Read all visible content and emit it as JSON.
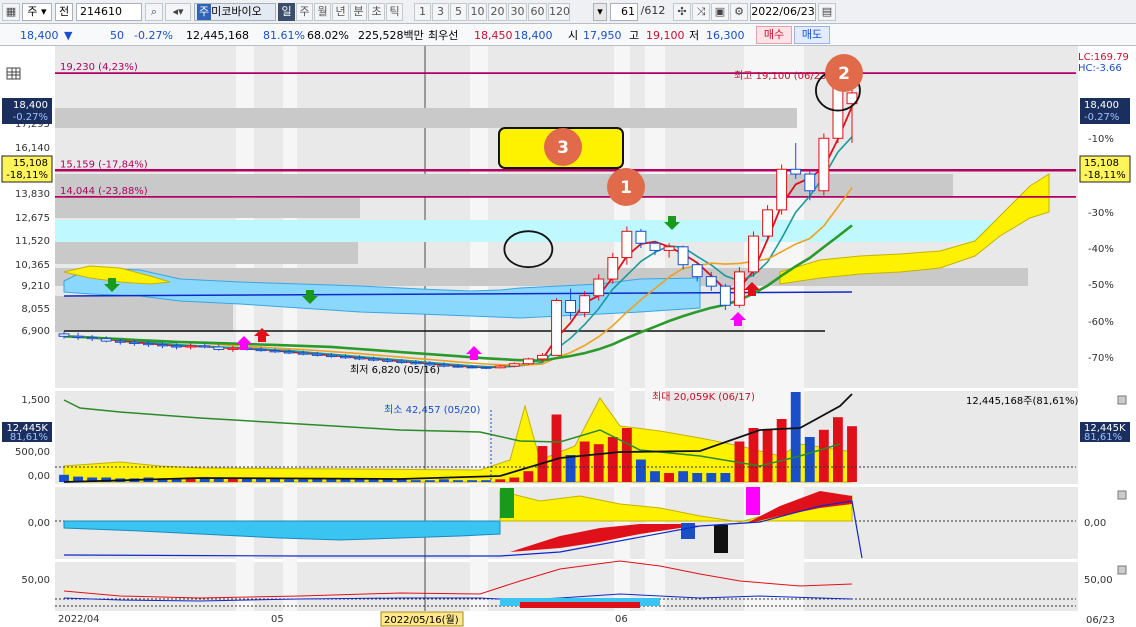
{
  "toolbar": {
    "market_type": "주",
    "scope": "전",
    "code": "214610",
    "stock_name": "미코바이오",
    "stock_prefix": "주",
    "periods": [
      "일",
      "주",
      "월",
      "년",
      "분",
      "초",
      "틱"
    ],
    "selected_period": "일",
    "intervals": [
      "1",
      "3",
      "5",
      "10",
      "20",
      "30",
      "60",
      "120"
    ],
    "count": "61",
    "total": "/612",
    "date": "2022/06/23"
  },
  "quote": {
    "price": "18,400",
    "direction": "▼",
    "change": "50",
    "change_pct": "-0.27%",
    "volume": "12,445,168",
    "volume_ratio": "81.61%",
    "turnover": "68.02%",
    "amount": "225,528백만",
    "best_ask_label": "최우선",
    "best_ask": "18,450",
    "best_bid": "18,400",
    "open_label": "시",
    "open": "17,950",
    "high_label": "고",
    "high": "19,100",
    "low_label": "저",
    "low": "16,300",
    "buy_label": "매수",
    "sell_label": "매도"
  },
  "chart": {
    "lc_hc": [
      "LC:169.79",
      "HC:-3.66"
    ],
    "price_ticks": [
      "17,295",
      "16,140",
      "13,830",
      "12,675",
      "11,520",
      "10,365",
      "9,210",
      "8,055",
      "6,900"
    ],
    "pct_ticks": [
      "-10%",
      "-20%",
      "-30%",
      "-40%",
      "-50%",
      "-60%",
      "-70%"
    ],
    "left_price_box": [
      "18,400",
      "-0.27%"
    ],
    "left_mid_box": [
      "15,108",
      "-18,11%"
    ],
    "right_price_box": [
      "18,400",
      "-0.27%"
    ],
    "right_mid_box": [
      "15,108",
      "-18,11%"
    ],
    "hlines": [
      {
        "label": "19,230 (4,23%)",
        "price": 19230
      },
      {
        "label": "15,159 (-17,84%)",
        "price": 15159
      },
      {
        "label": "14,044 (-23,88%)",
        "price": 14044
      }
    ],
    "high_annot": "최고 19,100 (06/23)",
    "low_annot": "최저 6,820 (05/16)",
    "badges": [
      "1",
      "2",
      "3"
    ],
    "vol_ticks": [
      "1,500",
      "500,00",
      "0,00"
    ],
    "vol_left_box": [
      "12,445K",
      "81,61%"
    ],
    "vol_right_box": [
      "12,445K",
      "81,61%"
    ],
    "vol_max_annot": "최대 20,059K (06/17)",
    "vol_min_annot": "최소 42,457 (05/20)",
    "vol_total": "12,445,168주(81,61%)",
    "macd_ticks": [
      "0,00"
    ],
    "macd_right": "0,00",
    "stoch_ticks": [
      "50,00"
    ],
    "stoch_right": "50,00",
    "x_labels": [
      "2022/04",
      "05",
      "06"
    ],
    "cursor_date": "2022/05/16(월)",
    "x_right_label": "06/23"
  },
  "chart_data": {
    "type": "candlestick",
    "title": "",
    "dates": [
      "04/01",
      "04/04",
      "04/05",
      "04/06",
      "04/07",
      "04/08",
      "04/11",
      "04/12",
      "04/13",
      "04/14",
      "04/15",
      "04/18",
      "04/19",
      "04/20",
      "04/21",
      "04/22",
      "04/25",
      "04/26",
      "04/27",
      "04/28",
      "04/29",
      "05/02",
      "05/03",
      "05/04",
      "05/06",
      "05/09",
      "05/10",
      "05/11",
      "05/12",
      "05/13",
      "05/16",
      "05/17",
      "05/18",
      "05/19",
      "05/20",
      "05/23",
      "05/24",
      "05/25",
      "05/26",
      "05/27",
      "05/30",
      "05/31",
      "06/02",
      "06/03",
      "06/07",
      "06/08",
      "06/09",
      "06/10",
      "06/13",
      "06/14",
      "06/15",
      "06/16",
      "06/17",
      "06/20",
      "06/21",
      "06/22",
      "06/23"
    ],
    "ohlc": [
      [
        8300,
        8400,
        8100,
        8200
      ],
      [
        8200,
        8350,
        8050,
        8150
      ],
      [
        8150,
        8250,
        8000,
        8100
      ],
      [
        8100,
        8200,
        7950,
        8000
      ],
      [
        8000,
        8100,
        7850,
        7950
      ],
      [
        7950,
        8050,
        7800,
        7900
      ],
      [
        7900,
        8000,
        7750,
        7850
      ],
      [
        7850,
        7950,
        7700,
        7800
      ],
      [
        7800,
        7900,
        7650,
        7750
      ],
      [
        7750,
        7900,
        7650,
        7800
      ],
      [
        7800,
        7900,
        7700,
        7750
      ],
      [
        7750,
        7850,
        7600,
        7650
      ],
      [
        7650,
        7800,
        7550,
        7700
      ],
      [
        7700,
        7800,
        7600,
        7650
      ],
      [
        7650,
        7750,
        7550,
        7600
      ],
      [
        7600,
        7700,
        7500,
        7550
      ],
      [
        7550,
        7650,
        7450,
        7500
      ],
      [
        7500,
        7600,
        7400,
        7450
      ],
      [
        7450,
        7550,
        7350,
        7400
      ],
      [
        7400,
        7500,
        7300,
        7350
      ],
      [
        7350,
        7450,
        7250,
        7300
      ],
      [
        7300,
        7400,
        7200,
        7250
      ],
      [
        7250,
        7350,
        7150,
        7200
      ],
      [
        7200,
        7300,
        7100,
        7150
      ],
      [
        7150,
        7250,
        7050,
        7100
      ],
      [
        7100,
        7200,
        7000,
        7050
      ],
      [
        7050,
        7150,
        6950,
        7000
      ],
      [
        7000,
        7100,
        6900,
        6950
      ],
      [
        6950,
        7050,
        6880,
        6920
      ],
      [
        6920,
        7000,
        6850,
        6900
      ],
      [
        6900,
        6950,
        6820,
        6880
      ],
      [
        6880,
        7000,
        6850,
        6950
      ],
      [
        6950,
        7100,
        6900,
        7050
      ],
      [
        7050,
        7300,
        7000,
        7250
      ],
      [
        7250,
        7500,
        7150,
        7400
      ],
      [
        7400,
        9800,
        7400,
        9700
      ],
      [
        9700,
        10200,
        8900,
        9200
      ],
      [
        9200,
        10100,
        9000,
        9900
      ],
      [
        9900,
        10800,
        9700,
        10600
      ],
      [
        10600,
        11700,
        10400,
        11500
      ],
      [
        11500,
        12800,
        11200,
        12600
      ],
      [
        12600,
        12700,
        11900,
        12100
      ],
      [
        12100,
        12200,
        11600,
        11800
      ],
      [
        11800,
        12100,
        11500,
        11950
      ],
      [
        11950,
        12000,
        11000,
        11200
      ],
      [
        11200,
        11300,
        10500,
        10700
      ],
      [
        10700,
        10900,
        10100,
        10300
      ],
      [
        10300,
        10400,
        9300,
        9500
      ],
      [
        9500,
        11100,
        9400,
        10900
      ],
      [
        10900,
        12600,
        10700,
        12400
      ],
      [
        12400,
        13700,
        12200,
        13500
      ],
      [
        13500,
        15400,
        13300,
        15200
      ],
      [
        15200,
        16300,
        14800,
        15000
      ],
      [
        15000,
        15100,
        13900,
        14300
      ],
      [
        14300,
        16700,
        14100,
        16500
      ],
      [
        16500,
        18800,
        16300,
        18600
      ],
      [
        17950,
        19100,
        16300,
        18400
      ]
    ],
    "annotations": {
      "max_high": 19100,
      "max_high_date": "06/23",
      "min_low": 6820,
      "min_low_date": "05/16"
    },
    "volume_max": "20,059K",
    "volume_max_date": "06/17",
    "volume_min": "42,457",
    "volume_min_date": "05/20",
    "ylim": [
      6200,
      20200
    ]
  }
}
